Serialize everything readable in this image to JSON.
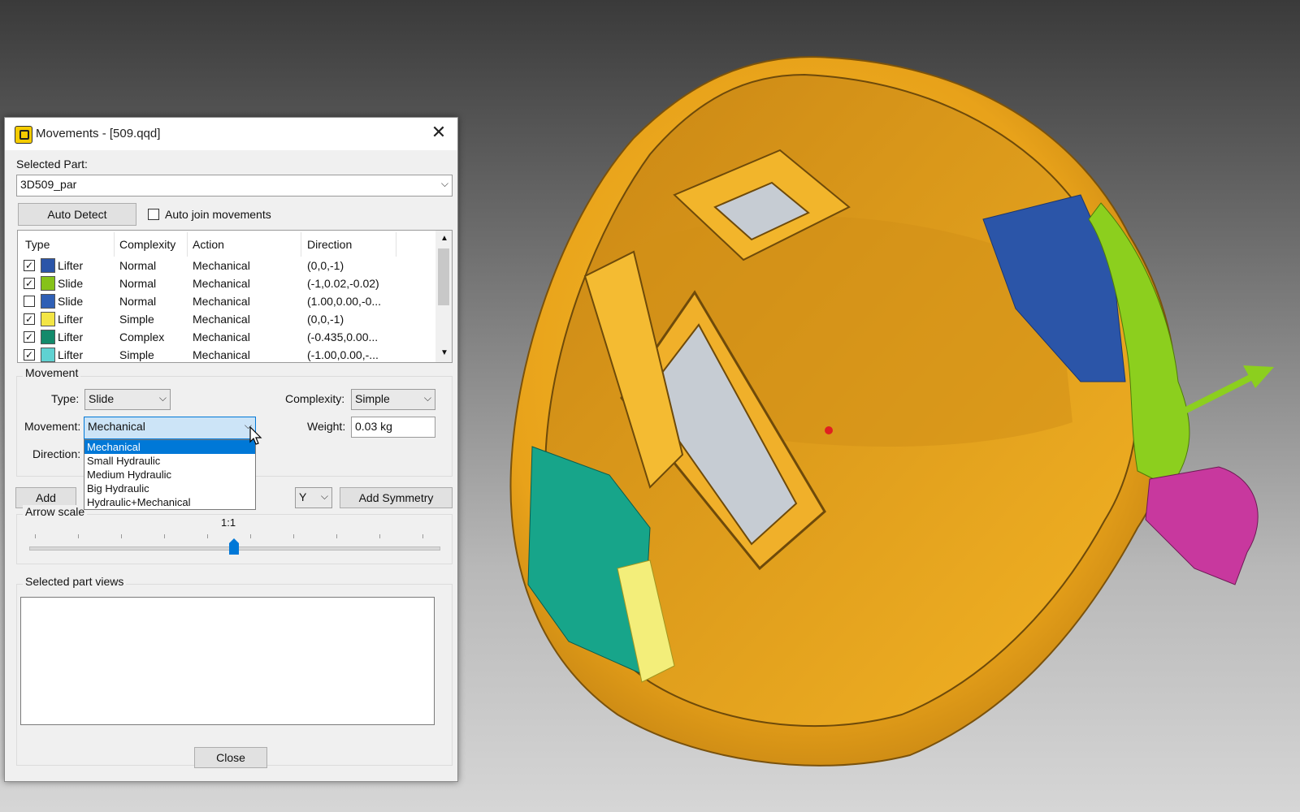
{
  "dialog": {
    "title": "Movements - [509.qqd]",
    "selected_part_label": "Selected Part:",
    "selected_part_value": "3D509_par",
    "auto_detect_label": "Auto Detect",
    "auto_join_label": "Auto join movements",
    "auto_join_checked": false,
    "table": {
      "columns": [
        "Type",
        "Complexity",
        "Action",
        "Direction"
      ],
      "rows": [
        {
          "checked": true,
          "color": "#2b55a8",
          "type": "Lifter",
          "complexity": "Normal",
          "action": "Mechanical",
          "direction": "(0,0,-1)"
        },
        {
          "checked": true,
          "color": "#86c21a",
          "type": "Slide",
          "complexity": "Normal",
          "action": "Mechanical",
          "direction": "(-1,0.02,-0.02)"
        },
        {
          "checked": false,
          "color": "#2f5fb5",
          "type": "Slide",
          "complexity": "Normal",
          "action": "Mechanical",
          "direction": "(1.00,0.00,-0..."
        },
        {
          "checked": true,
          "color": "#f3e545",
          "type": "Lifter",
          "complexity": "Simple",
          "action": "Mechanical",
          "direction": "(0,0,-1)"
        },
        {
          "checked": true,
          "color": "#138a6b",
          "type": "Lifter",
          "complexity": "Complex",
          "action": "Mechanical",
          "direction": "(-0.435,0.00..."
        },
        {
          "checked": true,
          "color": "#5fd2d2",
          "type": "Lifter",
          "complexity": "Simple",
          "action": "Mechanical",
          "direction": "(-1.00,0.00,-..."
        }
      ]
    },
    "movement_group": {
      "title": "Movement",
      "type_label": "Type:",
      "type_value": "Slide",
      "complexity_label": "Complexity:",
      "complexity_value": "Simple",
      "movement_label": "Movement:",
      "movement_value": "Mechanical",
      "weight_label": "Weight:",
      "weight_value": "0.03 kg",
      "direction_label": "Direction:",
      "movement_options": [
        "Mechanical",
        "Small Hydraulic",
        "Medium Hydraulic",
        "Big Hydraulic",
        "Hydraulic+Mechanical"
      ],
      "selected_option": "Mechanical"
    },
    "add_label": "Add",
    "axis_value": "Y",
    "add_symmetry_label": "Add Symmetry",
    "arrow_scale": {
      "title": "Arrow scale",
      "value_label": "1:1",
      "level": 0.5
    },
    "views_title": "Selected part views",
    "close_label": "Close"
  },
  "viewport": {
    "part_name": "3D509_par",
    "colors": {
      "part": "#f0a81e",
      "lifter_blue": "#2b55a8",
      "slide_green": "#8ccf1e",
      "lifter_teal": "#17a58a",
      "lifter_yellow": "#f3ee7a",
      "magenta": "#c8389e"
    }
  }
}
